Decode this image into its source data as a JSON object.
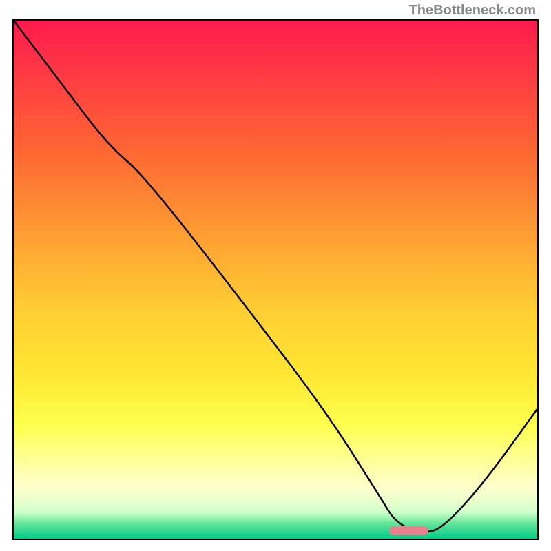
{
  "watermark": "TheBottleneck.com",
  "chart_data": {
    "type": "line",
    "title": "",
    "xlabel": "",
    "ylabel": "",
    "xlim": [
      0,
      100
    ],
    "ylim": [
      0,
      100
    ],
    "series": [
      {
        "name": "curve",
        "x_normalized": [
          0.0,
          0.09,
          0.18,
          0.25,
          0.45,
          0.6,
          0.7,
          0.73,
          0.78,
          0.82,
          0.9,
          1.0
        ],
        "y_normalized": [
          1.0,
          0.88,
          0.76,
          0.7,
          0.44,
          0.24,
          0.08,
          0.03,
          0.01,
          0.02,
          0.11,
          0.25
        ],
        "note": "y is fraction of plot height from bottom (1.0 = top, 0.0 = bottom)"
      }
    ],
    "marker": {
      "x_center_normalized": 0.755,
      "y_center_normalized": 0.015,
      "width_normalized": 0.075,
      "height_normalized": 0.018,
      "color": "#e8818d"
    },
    "background_gradient": {
      "orientation": "vertical",
      "stops": [
        {
          "pos": 0.0,
          "color": "#ff1a4d"
        },
        {
          "pos": 0.25,
          "color": "#ff6633"
        },
        {
          "pos": 0.55,
          "color": "#ffcc33"
        },
        {
          "pos": 0.78,
          "color": "#ffff4d"
        },
        {
          "pos": 0.92,
          "color": "#ffffcc"
        },
        {
          "pos": 1.0,
          "color": "#00cc88"
        }
      ]
    }
  }
}
